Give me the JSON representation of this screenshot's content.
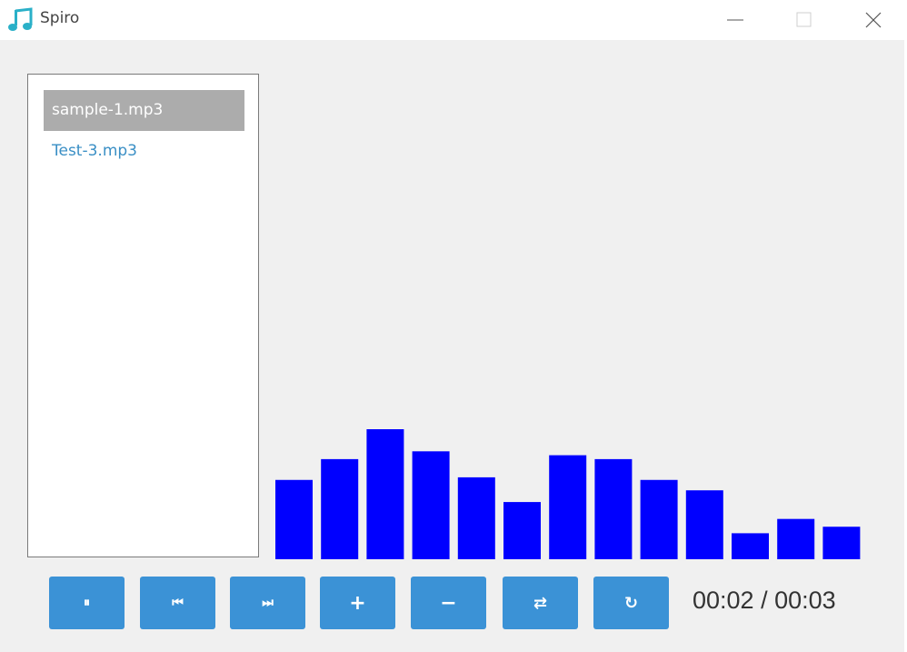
{
  "window": {
    "title": "Spiro",
    "accent": "#2ab0c8"
  },
  "playlist": {
    "items": [
      {
        "label": "sample-1.mp3",
        "selected": true
      },
      {
        "label": "Test-3.mp3",
        "selected": false
      }
    ]
  },
  "visualizer": {
    "bar_color": "#0000ff",
    "levels": [
      0.61,
      0.77,
      1.0,
      0.83,
      0.63,
      0.44,
      0.8,
      0.77,
      0.61,
      0.53,
      0.2,
      0.31,
      0.25
    ]
  },
  "controls": {
    "buttons": [
      {
        "name": "pause-button",
        "icon": "pause-icon",
        "glyph": "⏸"
      },
      {
        "name": "previous-button",
        "icon": "previous-icon",
        "glyph": "⏮"
      },
      {
        "name": "next-button",
        "icon": "next-icon",
        "glyph": "⏭"
      },
      {
        "name": "volume-up-button",
        "icon": "plus-icon",
        "glyph": "+"
      },
      {
        "name": "volume-down-button",
        "icon": "minus-icon",
        "glyph": "−"
      },
      {
        "name": "shuffle-button",
        "icon": "shuffle-icon",
        "glyph": "⇄"
      },
      {
        "name": "repeat-button",
        "icon": "repeat-icon",
        "glyph": "↻"
      }
    ],
    "button_color": "#3b92d6",
    "time": "00:02 / 00:03"
  }
}
